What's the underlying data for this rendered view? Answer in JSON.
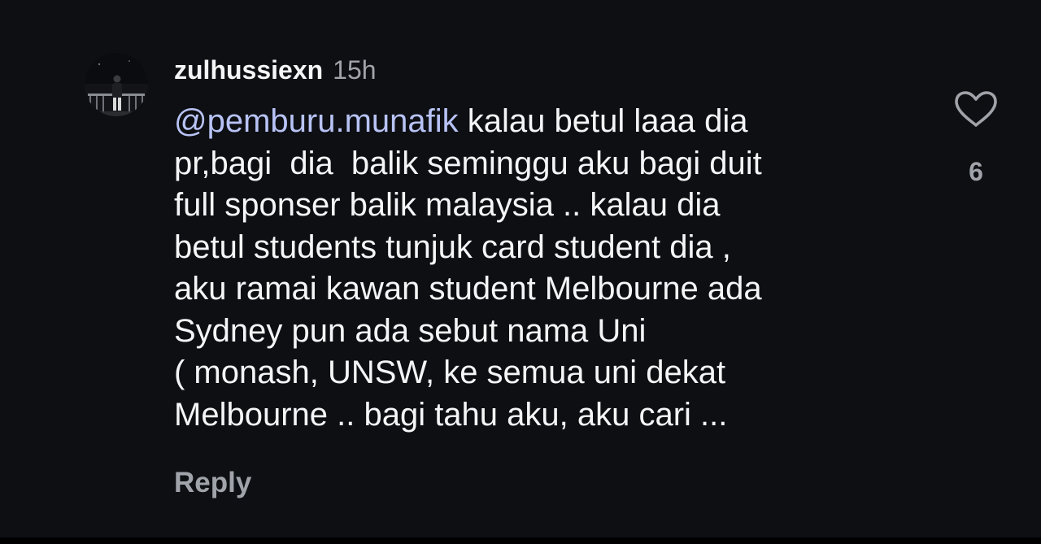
{
  "comment": {
    "username": "zulhussiexn",
    "timestamp": "15h",
    "mention": "@pemburu.munafik",
    "body_lines": [
      " kalau betul laaa dia",
      "pr,bagi  dia  balik seminggu aku bagi duit",
      "full sponser balik malaysia .. kalau dia",
      "betul students tunjuk card student dia ,",
      "aku ramai kawan student Melbourne ada",
      "Sydney pun ada sebut nama Uni",
      "( monash, UNSW, ke semua uni dekat",
      "Melbourne .. bagi tahu aku, aku cari ..."
    ],
    "reply_label": "Reply",
    "like_count": "6",
    "like_icon": "heart-outline-icon"
  },
  "colors": {
    "background": "#0d0f13",
    "text": "#f4f5f6",
    "secondary_text": "#a0a4aa",
    "mention": "#b8c3f5"
  }
}
